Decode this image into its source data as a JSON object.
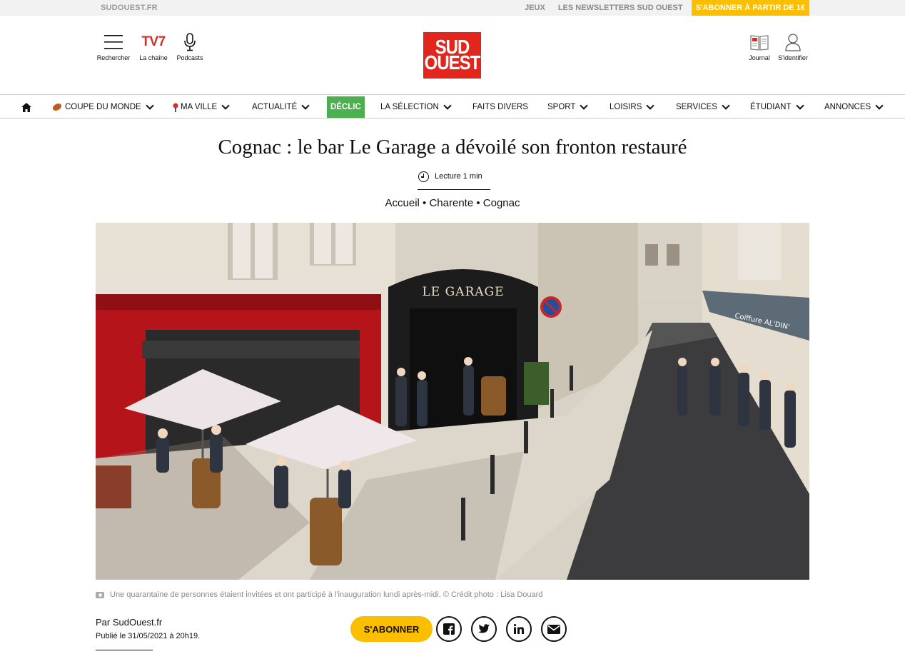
{
  "topbar": {
    "site": "SUDOUEST.FR",
    "links": [
      "JEUX",
      "LES NEWSLETTERS SUD OUEST"
    ],
    "subscribe": "S'ABONNER À PARTIR DE 1€"
  },
  "header": {
    "search_label": "Rechercher",
    "tv7_logo": "TV7",
    "channel_label": "La chaîne",
    "podcasts_label": "Podcasts",
    "logo_line1": "SUD",
    "logo_line2": "OUEST",
    "journal_label": "Journal",
    "login_label": "S'identifier"
  },
  "nav": {
    "items": [
      "COUPE DU MONDE",
      "MA VILLE",
      "ACTUALITÉ",
      "DÉCLIC",
      "LA SÉLECTION",
      "FAITS DIVERS",
      "SPORT",
      "LOISIRS",
      "SERVICES",
      "ÉTUDIANT",
      "ANNONCES"
    ]
  },
  "article": {
    "title": "Cognac : le bar Le Garage a dévoilé son fronton restauré",
    "reading_time": "Lecture 1 min",
    "breadcrumb": "Accueil • Charente • Cognac",
    "photo_sign": "LE GARAGE",
    "caption": "Une quarantaine de personnes étaient invitées et ont participé à l'inauguration lundi après-midi. © Crédit photo : Lisa Douard",
    "byline": "Par SudOuest.fr",
    "published": "Publié le 31/05/2021 à 20h19.",
    "subscribe_button": "S'ABONNER"
  },
  "colors": {
    "brand_red": "#e3261b",
    "subscribe_yellow": "#fbbf00",
    "declic_green": "#4caf50"
  }
}
